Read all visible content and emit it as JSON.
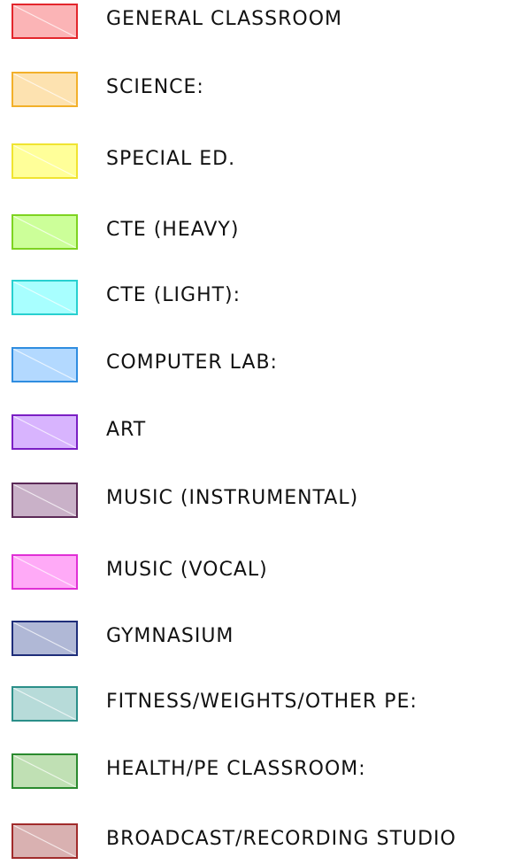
{
  "legend": {
    "items": [
      {
        "label": "GENERAL CLASSROOM",
        "fill": "#fbb4b6",
        "border": "#e3262c"
      },
      {
        "label": "SCIENCE:",
        "fill": "#fde2b0",
        "border": "#f2b02a"
      },
      {
        "label": "SPECIAL ED.",
        "fill": "#ffff99",
        "border": "#f0e431"
      },
      {
        "label": "CTE (HEAVY)",
        "fill": "#ccff99",
        "border": "#7ed321"
      },
      {
        "label": "CTE (LIGHT):",
        "fill": "#a8ffff",
        "border": "#28d0d0"
      },
      {
        "label": "COMPUTER LAB:",
        "fill": "#b3d9ff",
        "border": "#2f8de0"
      },
      {
        "label": "ART",
        "fill": "#d8b4fe",
        "border": "#7b1fc4"
      },
      {
        "label": "MUSIC (INSTRUMENTAL)",
        "fill": "#c9b1c8",
        "border": "#5c2a57"
      },
      {
        "label": "MUSIC (VOCAL)",
        "fill": "#ffaaf7",
        "border": "#e030d6"
      },
      {
        "label": "GYMNASIUM",
        "fill": "#b0b8d6",
        "border": "#1f2e7a"
      },
      {
        "label": "FITNESS/WEIGHTS/OTHER PE:",
        "fill": "#b7dbd9",
        "border": "#2b8f89"
      },
      {
        "label": "HEALTH/PE CLASSROOM:",
        "fill": "#c0e0b4",
        "border": "#2a8a2e"
      },
      {
        "label": "BROADCAST/RECORDING STUDIO",
        "fill": "#d9b1b1",
        "border": "#a12b2b"
      }
    ]
  }
}
